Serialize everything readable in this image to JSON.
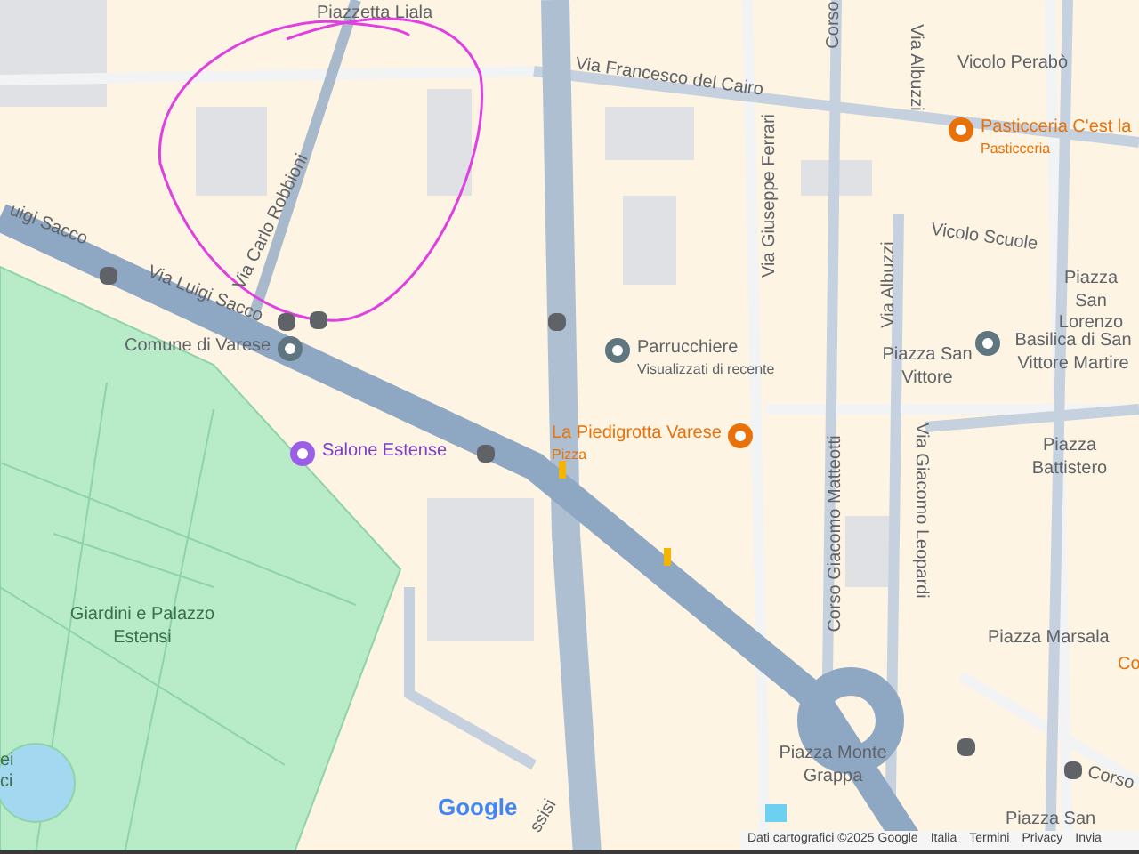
{
  "map": {
    "places": [
      {
        "name": "Piazzetta Liala",
        "kind": "square"
      },
      {
        "name": "Pasticceria C'est la",
        "subtitle": "Pasticceria",
        "kind": "food"
      },
      {
        "name": "Piazza San Lorenzo",
        "kind": "square"
      },
      {
        "name": "Comune di Varese",
        "kind": "office",
        "icon_after": true
      },
      {
        "name": "Parrucchiere",
        "subtitle": "Visualizzati di recente",
        "kind": "pin"
      },
      {
        "name": "Piazza San Vittore",
        "kind": "square"
      },
      {
        "name": "Basilica di San Vittore Martire",
        "kind": "church"
      },
      {
        "name": "Salone Estense",
        "kind": "venue"
      },
      {
        "name": "La Piedigrotta Varese",
        "subtitle": "Pizza",
        "kind": "food",
        "icon_after": true
      },
      {
        "name": "Piazza Battistero",
        "kind": "square"
      },
      {
        "name": "Giardini e Palazzo Estensi",
        "kind": "park"
      },
      {
        "name": "Piazza Marsala",
        "kind": "square"
      },
      {
        "name": "Co",
        "kind": "edgefood"
      },
      {
        "name": "ei",
        "kind": "park"
      },
      {
        "name": "ci",
        "kind": "park"
      },
      {
        "name": "Piazza Monte Grappa",
        "kind": "square"
      },
      {
        "name": "Piazza San",
        "kind": "square"
      }
    ],
    "streets": [
      {
        "name": "Corso"
      },
      {
        "name": "Via Albuzzi"
      },
      {
        "name": "Via Francesco del Cairo"
      },
      {
        "name": "Vicolo Perabò"
      },
      {
        "name": "Via Giuseppe Ferrari"
      },
      {
        "name": "Via Carlo Robbioni"
      },
      {
        "name": "uigi Sacco"
      },
      {
        "name": "Vicolo Scuole"
      },
      {
        "name": "Via Albuzzi"
      },
      {
        "name": "Via Luigi Sacco"
      },
      {
        "name": "Via Giacomo Leopardi"
      },
      {
        "name": "Corso Giacomo Matteotti"
      },
      {
        "name": "Corso"
      },
      {
        "name": "ssisi"
      }
    ],
    "logo": "Google",
    "footer": {
      "attribution": "Dati cartografici ©2025 Google",
      "links": [
        "Italia",
        "Termini",
        "Privacy",
        "Invia"
      ]
    }
  }
}
